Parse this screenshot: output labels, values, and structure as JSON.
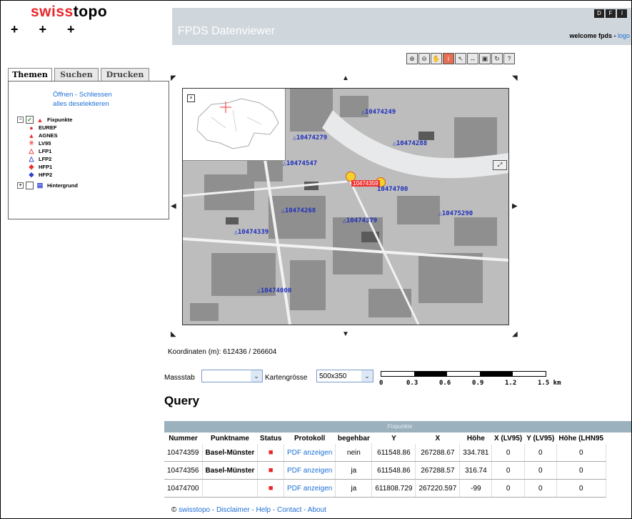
{
  "header": {
    "logo_red": "swiss",
    "logo_black": "topo",
    "crosses": "+ + +",
    "app_title": "FPDS Datenviewer",
    "lang_buttons": [
      "D",
      "F",
      "I"
    ],
    "welcome_text": "welcome fpds - ",
    "logout_label": "logo"
  },
  "tabs": [
    "Themen",
    "Suchen",
    "Drucken"
  ],
  "panel": {
    "open_link": "Öffnen",
    "separator": " - ",
    "close_link": "Schliessen",
    "deselect_link": "alles deselektieren",
    "layers": [
      {
        "label": "Fixpunkte",
        "symbol": "▲",
        "color": "#e83030"
      },
      {
        "label": "EUREF",
        "symbol": "●",
        "color": "#e83030"
      },
      {
        "label": "AGNES",
        "symbol": "▲",
        "color": "#e83030"
      },
      {
        "label": "LV95",
        "symbol": "✳",
        "color": "#e86060"
      },
      {
        "label": "LFP1",
        "symbol": "△",
        "color": "#e83030"
      },
      {
        "label": "LFP2",
        "symbol": "△",
        "color": "#3040d0"
      },
      {
        "label": "HFP1",
        "symbol": "◆",
        "color": "#e83030"
      },
      {
        "label": "HFP2",
        "symbol": "◆",
        "color": "#3040d0"
      }
    ],
    "background_label": "Hintergrund"
  },
  "toolbar_icons": [
    "zoom-in-icon",
    "zoom-out-icon",
    "pan-icon",
    "info-icon",
    "select-icon",
    "measure-icon",
    "print-icon",
    "refresh-icon",
    "help-icon"
  ],
  "map": {
    "points": [
      "10474249",
      "10474279",
      "10474288",
      "10474547",
      "10474700",
      "10474268",
      "10474379",
      "10474339",
      "10475290",
      "10474000"
    ],
    "highlight_label": "10474359"
  },
  "coordinates": {
    "label": "Koordinaten (m):",
    "value": "612436 / 266604"
  },
  "controls": {
    "massstab_label": "Massstab",
    "massstab_value": "",
    "kartengroesse_label": "Kartengrösse",
    "kartengroesse_value": "500x350",
    "scale_labels": [
      "0",
      "0.3",
      "0.6",
      "0.9",
      "1.2",
      "1.5 km"
    ]
  },
  "query": {
    "title": "Query",
    "table_caption": "Fixpunkte",
    "columns": [
      "Nummer",
      "Punktname",
      "Status",
      "Protokoll",
      "begehbar",
      "Y",
      "X",
      "Höhe",
      "X (LV95)",
      "Y (LV95)",
      "Höhe (LHN95"
    ],
    "rows": [
      [
        "10474359",
        "Basel-Münster",
        "■",
        "PDF anzeigen",
        "nein",
        "611548.86",
        "267288.67",
        "334.781",
        "0",
        "0",
        "0"
      ],
      [
        "10474356",
        "Basel-Münster",
        "■",
        "PDF anzeigen",
        "ja",
        "611548.86",
        "267288.57",
        "316.74",
        "0",
        "0",
        "0"
      ],
      [
        "10474700",
        "",
        "■",
        "PDF anzeigen",
        "ja",
        "611808.729",
        "267220.597",
        "-99",
        "0",
        "0",
        "0"
      ]
    ]
  },
  "footer": {
    "copyright": "© ",
    "links": [
      "swisstopo",
      "Disclaimer",
      "Help",
      "Contact",
      "About"
    ]
  }
}
